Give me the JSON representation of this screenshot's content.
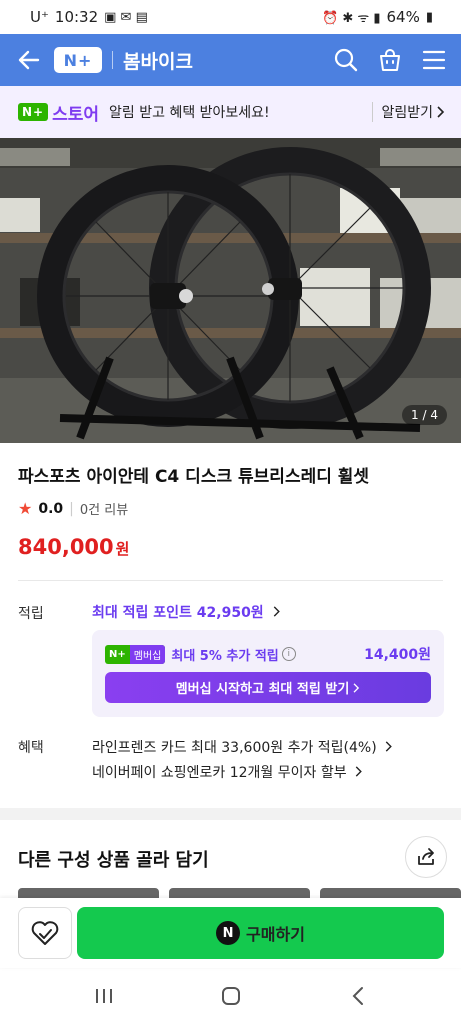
{
  "status": {
    "carrier": "U⁺",
    "time": "10:32",
    "battery": "64%"
  },
  "header": {
    "logo": "N+",
    "title": "봄바이크"
  },
  "promo": {
    "brand": "스토어",
    "message": "알림 받고 혜택 받아보세요!",
    "link": "알림받기"
  },
  "product": {
    "image_counter": "1 / 4",
    "title": "파스포츠 아이안테 C4 디스크 튜브리스레디 휠셋",
    "rating": "0.0",
    "reviews": "0건 리뷰",
    "price": "840,000",
    "price_unit": "원"
  },
  "points": {
    "label": "적립",
    "max_points": "최대 적립 포인트 42,950원",
    "badge_n": "N+",
    "badge_member": "멤버십",
    "extra": "최대 5% 추가 적립",
    "extra_amount": "14,400원",
    "cta": "멤버십 시작하고 최대 적립 받기"
  },
  "benefits": {
    "label": "혜택",
    "lines": [
      "라인프렌즈 카드 최대 33,600원 추가 적립(4%)",
      "네이버페이 쇼핑엔로카 12개월 무이자 할부"
    ]
  },
  "section": {
    "title": "다른 구성 상품 골라 담기"
  },
  "bottom": {
    "buy_label": "구매하기",
    "buy_icon": "N"
  },
  "colors": {
    "header": "#4c80e0",
    "accent_purple": "#6b3cf0",
    "price_red": "#e02020",
    "buy_green": "#14c94e"
  }
}
